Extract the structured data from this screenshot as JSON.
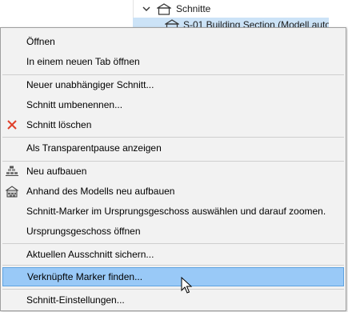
{
  "tree": {
    "folder_label": "Schnitte",
    "section_label": "S-01 Building Section (Modell auto"
  },
  "menu": {
    "items": [
      {
        "label": "Öffnen"
      },
      {
        "label": "In einem neuen Tab öffnen"
      },
      {
        "label": "Neuer unabhängiger Schnitt..."
      },
      {
        "label": "Schnitt umbenennen..."
      },
      {
        "label": "Schnitt löschen",
        "icon": "delete-x-icon"
      },
      {
        "label": "Als Transparentpause anzeigen"
      },
      {
        "label": "Neu aufbauen",
        "icon": "rebuild-icon"
      },
      {
        "label": "Anhand des Modells neu aufbauen",
        "icon": "rebuild-from-model-icon"
      },
      {
        "label": "Schnitt-Marker im Ursprungsgeschoss auswählen und darauf zoomen."
      },
      {
        "label": "Ursprungsgeschoss öffnen"
      },
      {
        "label": "Aktuellen Ausschnitt sichern..."
      },
      {
        "label": "Verknüpfte Marker finden...",
        "highlighted": true
      },
      {
        "label": "Schnitt-Einstellungen..."
      }
    ]
  },
  "colors": {
    "menu_bg": "#f2f2f2",
    "highlight": "#99c9f7",
    "highlight_border": "#5fa3e0",
    "tree_selection": "#cce3f7",
    "delete_icon": "#e0402a"
  }
}
